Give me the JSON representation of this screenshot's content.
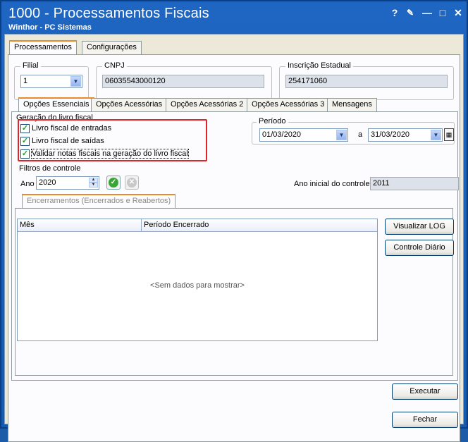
{
  "window": {
    "title": "1000 - Processamentos Fiscais",
    "subtitle": "Winthor - PC Sistemas",
    "controls": {
      "help": "?",
      "edit": "✎",
      "minimize": "—",
      "maximize": "□",
      "close": "✕"
    }
  },
  "top_tabs": [
    {
      "label": "Processamentos",
      "active": true
    },
    {
      "label": "Configurações",
      "active": false
    }
  ],
  "header": {
    "filial_label": "Filial",
    "filial_value": "1",
    "cnpj_label": "CNPJ",
    "cnpj_value": "06035543000120",
    "ie_label": "Inscrição Estadual",
    "ie_value": "254171060"
  },
  "inner_tabs": [
    {
      "label": "Opções Essenciais",
      "active": true
    },
    {
      "label": "Opções Acessórias",
      "active": false
    },
    {
      "label": "Opções Acessórias 2",
      "active": false
    },
    {
      "label": "Opções Acessórias 3",
      "active": false
    },
    {
      "label": "Mensagens",
      "active": false
    }
  ],
  "geracao": {
    "group_label": "Geração do livro fiscal",
    "checks": [
      {
        "label": "Livro fiscal de entradas",
        "checked": true
      },
      {
        "label": "Livro fiscal de saídas",
        "checked": true
      },
      {
        "label": "Validar notas fiscais na geração do livro fiscal",
        "checked": true
      }
    ]
  },
  "periodo": {
    "label": "Período",
    "start": "01/03/2020",
    "separator": "a",
    "end": "31/03/2020"
  },
  "filtros": {
    "label": "Filtros de controle",
    "ano_label": "Ano",
    "ano_value": "2020",
    "ano_inicial_label": "Ano inicial do controle",
    "ano_inicial_value": "2011"
  },
  "encerramentos": {
    "tab_label": "Encerramentos (Encerrados e Reabertos)",
    "columns": [
      "Mês",
      "Período Encerrado"
    ],
    "empty_text": "<Sem dados para mostrar>",
    "visualizar_log": "Visualizar LOG",
    "controle_diario": "Controle Diário"
  },
  "actions": {
    "executar": "Executar",
    "fechar": "Fechar"
  },
  "colors": {
    "title_bar": "#1f66c2",
    "highlight": "#e0242a",
    "active_tab": "#e68b2c"
  }
}
